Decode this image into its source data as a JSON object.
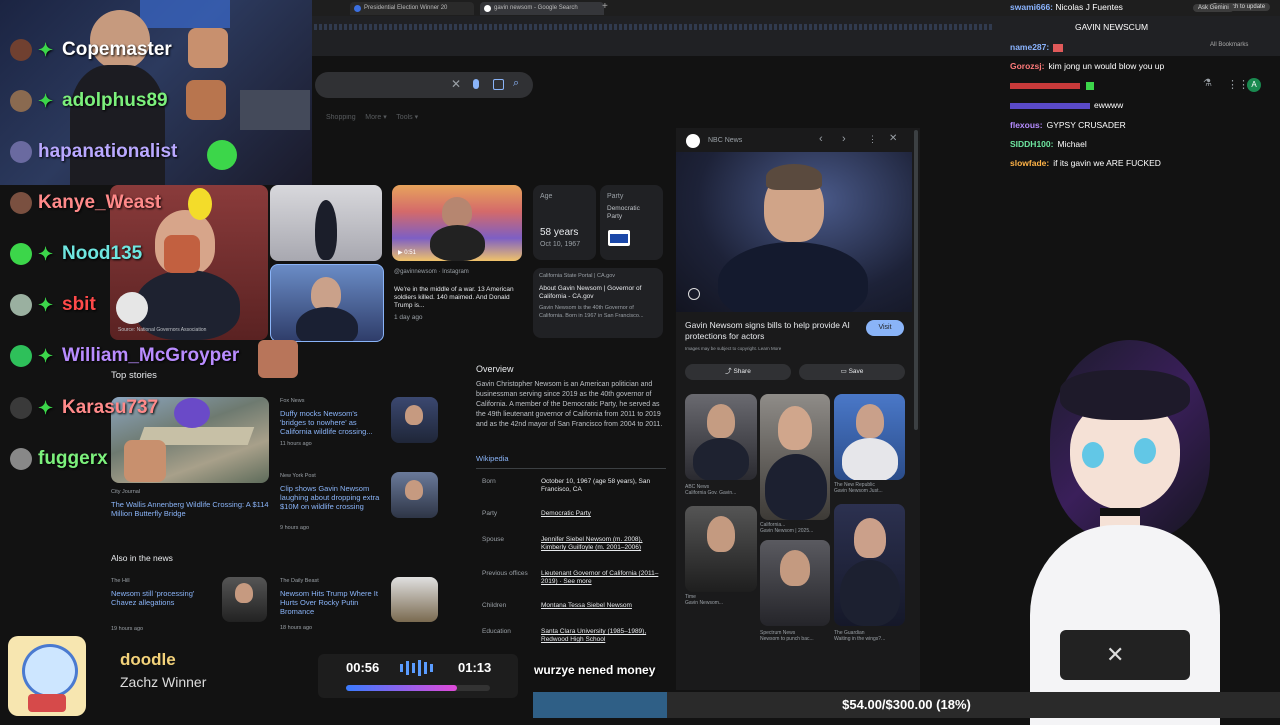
{
  "browser": {
    "tabs": [
      "Presidential Election Winner 20",
      "gavin newsom - Google Search"
    ],
    "relaunch": "Relaunch to update",
    "all_bookmarks": "All Bookmarks"
  },
  "left_chat": [
    {
      "name": "Copemaster",
      "color": "#ffffff"
    },
    {
      "name": "adolphus89",
      "color": "#7cf07c"
    },
    {
      "name": "hapanationalist",
      "color": "#b9a8ff"
    },
    {
      "name": "Kanye_Weast",
      "color": "#ff8a8a"
    },
    {
      "name": "Nood135",
      "color": "#6ee6e0"
    },
    {
      "name": "sbit",
      "color": "#ff4a4a"
    },
    {
      "name": "William_McGroyper",
      "color": "#b98cff"
    },
    {
      "name": "Karasu737",
      "color": "#ff8a8a"
    },
    {
      "name": "fuggerx",
      "color": "#7cf07c"
    }
  ],
  "knowledge": {
    "age_label": "Age",
    "age_value": "58 years",
    "birth_date": "Oct 10, 1967",
    "party_label": "Party",
    "party_value": "Democratic Party",
    "post_source": "@gavinnewsom · Instagram",
    "post_text": "We're in the middle of a war. 13 American soldiers killed. 140 maimed. And Donald Trump is...",
    "post_time": "1 day ago",
    "ca_source": "California State Portal | CA.gov",
    "ca_title": "About Gavin Newsom | Governor of California - CA.gov",
    "ca_text": "Gavin Newsom is the 40th Governor of California. Born in 1967 in San Francisco...",
    "image_credit": "Source: National Governors Association",
    "top_stories": "Top stories",
    "overview_heading": "Overview",
    "overview_text": "Gavin Christopher Newsom is an American politician and businessman serving since 2019 as the 40th governor of California. A member of the Democratic Party, he served as the 49th lieutenant governor of California from 2011 to 2019 and as the 42nd mayor of San Francisco from 2004 to 2011.",
    "wikipedia": "Wikipedia",
    "facts": [
      {
        "label": "Born",
        "value": "October 10, 1967 (age 58 years), San Francisco, CA"
      },
      {
        "label": "Party",
        "value": "Democratic Party"
      },
      {
        "label": "Spouse",
        "value": "Jennifer Siebel Newsom (m. 2008), Kimberly Guilfoyle (m. 2001–2006)"
      },
      {
        "label": "Previous offices",
        "value": "Lieutenant Governor of California (2011–2019) · See more"
      },
      {
        "label": "Children",
        "value": "Montana Tessa Siebel Newsom"
      },
      {
        "label": "Education",
        "value": "Santa Clara University (1985–1989), Redwood High School"
      }
    ],
    "stories": [
      {
        "source": "Fox News",
        "title": "Duffy mocks Newsom's 'bridges to nowhere' as California wildlife crossing...",
        "time": "11 hours ago"
      },
      {
        "source": "New York Post",
        "title": "Clip shows Gavin Newsom laughing about dropping extra $10M on wildlife crossing",
        "time": "9 hours ago"
      },
      {
        "source": "City Journal",
        "title": "The Wallis Annenberg Wildlife Crossing: A $114 Million Butterfly Bridge",
        "time": ""
      }
    ],
    "also_heading": "Also in the news",
    "also": [
      {
        "source": "The Hill",
        "title": "Newsom still 'processing' Chavez allegations",
        "time": "19 hours ago"
      },
      {
        "source": "The Daily Beast",
        "title": "Newsom Hits Trump Where It Hurts Over Rocky Putin Bromance",
        "time": "18 hours ago"
      }
    ]
  },
  "viewer": {
    "source": "NBC News",
    "caption": "Gavin Newsom signs bills to help provide AI protections for actors",
    "visit": "Visit",
    "share": "Share",
    "save": "Save",
    "notice": "Images may be subject to copyright. Learn More",
    "grid_labels": [
      {
        "source": "ABC News",
        "title": "California Gov. Gavin..."
      },
      {
        "source": "California...",
        "title": "Gavin Newsom | 2025..."
      },
      {
        "source": "The New Republic",
        "title": "Gavin Newsom Just..."
      },
      {
        "source": "Time",
        "title": "Gavin Newsom..."
      },
      {
        "source": "Spectrum News",
        "title": "Newsom to punch bac..."
      },
      {
        "source": "The Guardian",
        "title": "Waiting in the wings?..."
      }
    ]
  },
  "right_chat": {
    "header_user": "swami666:",
    "header_msg": "Nicolas J Fuentes",
    "header2": "GAVIN NEWSCUM",
    "ask": "Ask Gemini",
    "messages": [
      {
        "user": "name287:",
        "msg": "",
        "color": "#8ab4ff"
      },
      {
        "user": "Gorozsj:",
        "msg": "kim jong un would blow you up",
        "color": "#ff7b7b"
      },
      {
        "user": "",
        "msg": "ewwww",
        "color": "#ff5c5c"
      },
      {
        "user": "flexous:",
        "msg": "GYPSY CRUSADER",
        "color": "#b58cff"
      },
      {
        "user": "SIDDH100:",
        "msg": "Michael",
        "color": "#6ee6a0"
      },
      {
        "user": "slowfade:",
        "msg": "if its gavin we ARE FUCKED",
        "color": "#ffb347"
      }
    ]
  },
  "overlay": {
    "doodle": "doodle",
    "winner": "Zachz Winner",
    "time_current": "00:56",
    "time_total": "01:13",
    "tts_text": "wurzye nened money",
    "donation": "$54.00/$300.00 (18%)",
    "donation_progress": 0.18,
    "timer_progress": 0.77
  }
}
